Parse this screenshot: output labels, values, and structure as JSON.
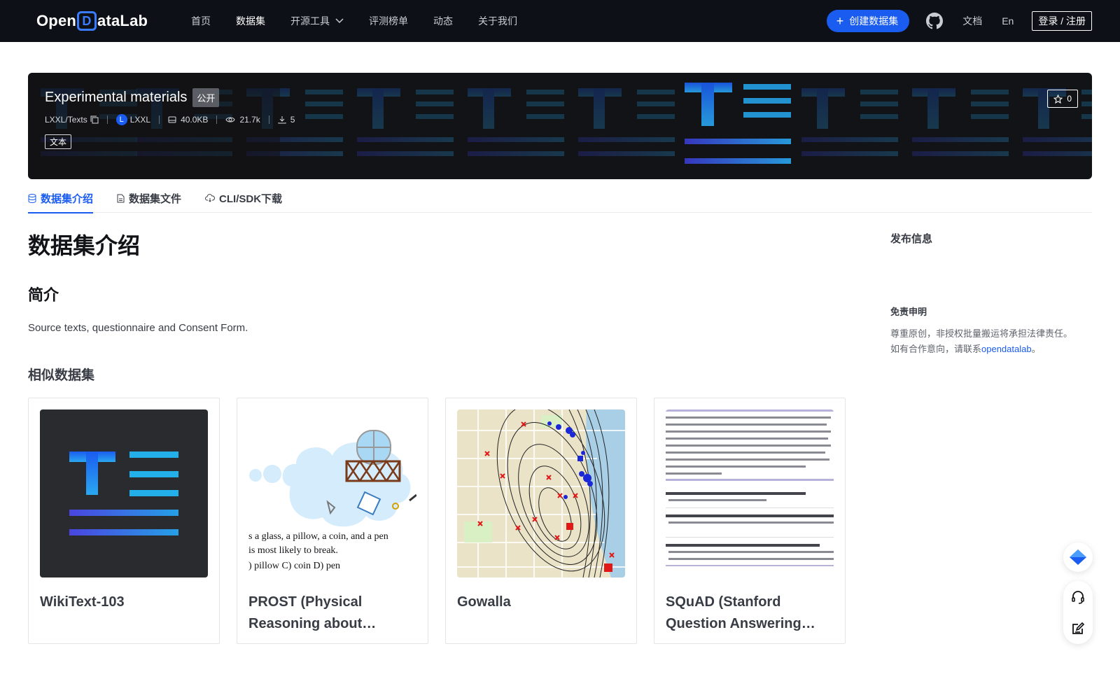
{
  "nav": {
    "logo_text_left": "Open",
    "logo_text_d": "D",
    "logo_text_right": "ataLab",
    "menu": [
      {
        "label": "首页"
      },
      {
        "label": "数据集"
      },
      {
        "label": "开源工具"
      },
      {
        "label": "评测榜单"
      },
      {
        "label": "动态"
      },
      {
        "label": "关于我们"
      }
    ],
    "create_label": "创建数据集",
    "docs_label": "文档",
    "lang_label": "En",
    "login_label": "登录 / 注册"
  },
  "dataset": {
    "title": "Experimental materials",
    "visibility": "公开",
    "repo": "LXXL/Texts",
    "owner_initial": "L",
    "owner": "LXXL",
    "size": "40.0KB",
    "views": "21.7k",
    "downloads": "5",
    "type_tag": "文本",
    "stars": "0"
  },
  "tabs": [
    {
      "label": "数据集介绍"
    },
    {
      "label": "数据集文件"
    },
    {
      "label": "CLI/SDK下载"
    }
  ],
  "intro": {
    "heading": "数据集介绍",
    "summary_heading": "简介",
    "summary_text": "Source texts, questionnaire and Consent Form.",
    "similar_heading": "相似数据集"
  },
  "similar": [
    {
      "title": "WikiText-103"
    },
    {
      "title": "PROST (Physical Reasoning about…"
    },
    {
      "title": "Gowalla"
    },
    {
      "title": "SQuAD (Stanford Question Answering…"
    }
  ],
  "prost_thumb": {
    "line1": "s a glass, a pillow, a coin, and a pen",
    "line2": "is most likely to break.",
    "line3": ") pillow     C) coin          D) pen"
  },
  "sidebar": {
    "release_heading": "发布信息",
    "disclaimer_heading": "免责申明",
    "disclaimer_line1": "尊重原创，非授权批量搬运将承担法律责任。",
    "disclaimer_line2_prefix": "如有合作意向，请联系",
    "disclaimer_link": "opendatalab",
    "disclaimer_line2_suffix": "。"
  },
  "colors": {
    "nav_bg": "#0d1117",
    "accent": "#1a5cf0",
    "banner_bg": "#121316"
  }
}
